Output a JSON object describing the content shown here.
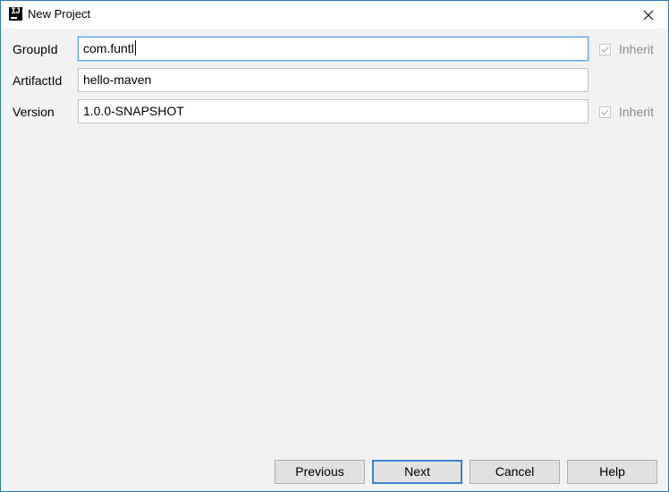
{
  "window": {
    "title": "New Project",
    "app_icon": "intellij-idea-icon",
    "close_icon": "close-icon"
  },
  "form": {
    "group_id": {
      "label": "GroupId",
      "value": "com.funtl",
      "inherit_label": "Inherit",
      "inherit_checked": true,
      "inherit_enabled": false
    },
    "artifact_id": {
      "label": "ArtifactId",
      "value": "hello-maven"
    },
    "version": {
      "label": "Version",
      "value": "1.0.0-SNAPSHOT",
      "inherit_label": "Inherit",
      "inherit_checked": true,
      "inherit_enabled": false
    }
  },
  "buttons": {
    "previous": "Previous",
    "next": "Next",
    "cancel": "Cancel",
    "help": "Help"
  },
  "colors": {
    "window_border": "#2b78c4",
    "focus_border": "#5fa0e6",
    "default_button_border": "#3b83cf",
    "disabled_text": "#8c8c8c"
  }
}
